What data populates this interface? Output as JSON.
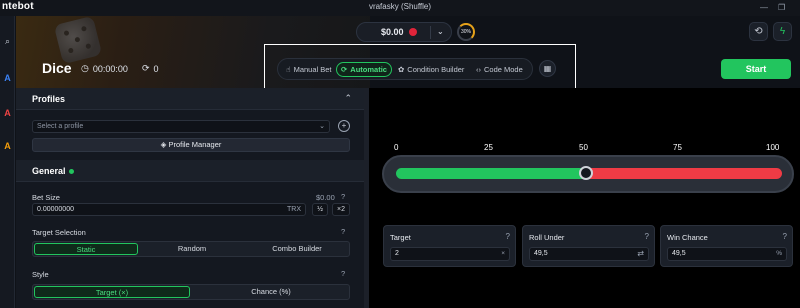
{
  "app": {
    "logo": "ntebot",
    "window_title": "vrafasky (Shuffle)"
  },
  "header": {
    "game_title": "Dice",
    "timer": "00:00:00",
    "round_count": "0",
    "balance": "$0.00",
    "wager_progress": "30%",
    "start_label": "Start"
  },
  "modes": [
    {
      "label": "Manual Bet",
      "active": false
    },
    {
      "label": "Automatic",
      "active": true
    },
    {
      "label": "Condition Builder",
      "active": false
    },
    {
      "label": "Code Mode",
      "active": false
    }
  ],
  "profiles": {
    "title": "Profiles",
    "select_placeholder": "Select a profile",
    "manager_label": "Profile Manager"
  },
  "general": {
    "title": "General",
    "bet_size_label": "Bet Size",
    "bet_size_usd": "$0.00",
    "bet_size_value": "0.00000000",
    "currency": "TRX",
    "half_label": "½",
    "double_label": "×2",
    "target_selection_label": "Target Selection",
    "target_options": [
      "Static",
      "Random",
      "Combo Builder"
    ],
    "target_selected": "Static",
    "style_label": "Style",
    "style_options": [
      "Target (×)",
      "Chance (%)"
    ],
    "style_selected": "Target (×)"
  },
  "slider": {
    "ticks": [
      "0",
      "25",
      "50",
      "75",
      "100"
    ],
    "value": 50
  },
  "stats": {
    "target": {
      "label": "Target",
      "value": "2",
      "suffix": "×"
    },
    "roll_under": {
      "label": "Roll Under",
      "value": "49,5"
    },
    "win_chance": {
      "label": "Win Chance",
      "value": "49,5",
      "suffix": "%"
    }
  },
  "colors": {
    "accent_green": "#22c55e",
    "loss_red": "#ef3b45",
    "gem_red": "#e0243a",
    "progress_orange": "#e6a21a"
  }
}
